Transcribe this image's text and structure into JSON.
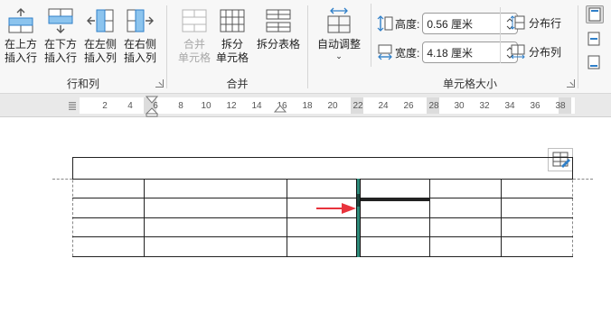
{
  "ribbon": {
    "rows_cols": {
      "label": "行和列",
      "buttons": [
        {
          "label": "在上方\n插入行"
        },
        {
          "label": "在下方\n插入行"
        },
        {
          "label": "在左侧\n插入列"
        },
        {
          "label": "在右侧\n插入列"
        }
      ]
    },
    "merge": {
      "label": "合并",
      "buttons": [
        {
          "label": "合并\n单元格",
          "disabled": true
        },
        {
          "label": "拆分\n单元格"
        },
        {
          "label": "拆分表格"
        }
      ]
    },
    "cell_size": {
      "label": "单元格大小",
      "autofit_label": "自动调整",
      "height_label": "高度:",
      "height_value": "0.56 厘米",
      "width_label": "宽度:",
      "width_value": "4.18 厘米",
      "distribute_rows": "分布行",
      "distribute_cols": "分布列"
    }
  },
  "ruler": {
    "ticks": [
      "2",
      "4",
      "6",
      "8",
      "10",
      "12",
      "14",
      "16",
      "18",
      "20",
      "22",
      "24",
      "26",
      "28",
      "30",
      "32",
      "34",
      "36",
      "38"
    ]
  },
  "colors": {
    "accent": "#2f7fc8",
    "column_highlight": "#2e8b7a",
    "arrow": "#e8333c",
    "ribbon_bg": "#f7f7f7"
  }
}
